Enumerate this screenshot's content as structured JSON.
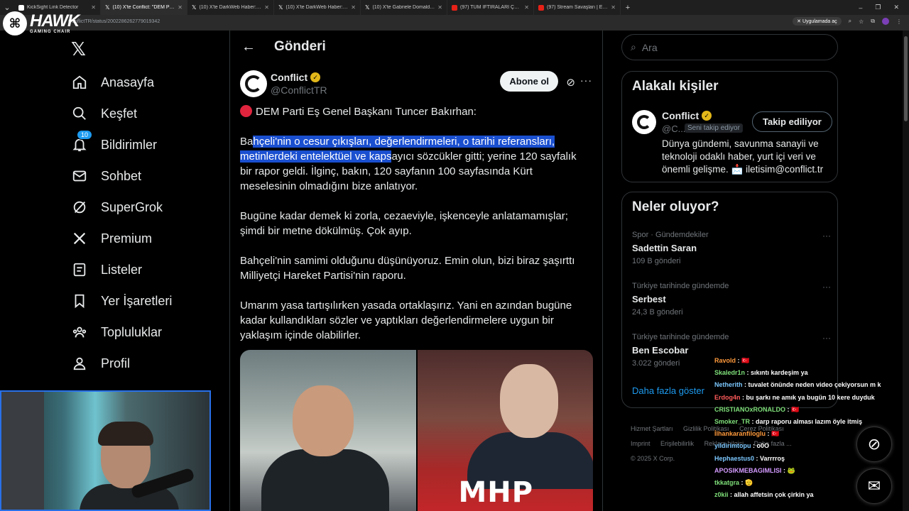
{
  "browser": {
    "tabs": [
      {
        "title": "KickSight Link Detector",
        "active": false,
        "favicon": "kick-icon"
      },
      {
        "title": "(10) X'te Conflict: \"DEM Parti",
        "active": true,
        "favicon": "x-icon"
      },
      {
        "title": "(10) X'te DarkWeb Haber: \"#Son",
        "active": false,
        "favicon": "x-icon"
      },
      {
        "title": "(10) X'te DarkWeb Haber: \"Bilal",
        "active": false,
        "favicon": "x-icon"
      },
      {
        "title": "(10) X'te Gabriele Domaldo: \"Su",
        "active": false,
        "favicon": "x-icon"
      },
      {
        "title": "(97) TÜM İFTİRALARI ÇÖZDÜM",
        "active": false,
        "favicon": "youtube-icon"
      },
      {
        "title": "(97) Stream Savaşları | Ebo x Uz",
        "active": false,
        "favicon": "youtube-icon"
      }
    ],
    "url": "ConflictTR/status/2002286262779019342",
    "install_label": "Uygulamada aç"
  },
  "overlay_logo": {
    "word": "HAWK",
    "sub": "GAMING CHAIR"
  },
  "nav": {
    "items": [
      {
        "label": "Anasayfa",
        "icon": "home-icon"
      },
      {
        "label": "Keşfet",
        "icon": "search-icon"
      },
      {
        "label": "Bildirimler",
        "icon": "bell-icon",
        "badge": "10"
      },
      {
        "label": "Sohbet",
        "icon": "mail-icon"
      },
      {
        "label": "SuperGrok",
        "icon": "grok-icon"
      },
      {
        "label": "Premium",
        "icon": "x-icon"
      },
      {
        "label": "Listeler",
        "icon": "list-icon"
      },
      {
        "label": "Yer İşaretleri",
        "icon": "bookmark-icon"
      },
      {
        "label": "Topluluklar",
        "icon": "communities-icon"
      },
      {
        "label": "Profil",
        "icon": "person-icon"
      }
    ]
  },
  "main": {
    "header_title": "Gönderi",
    "author_name": "Conflict",
    "author_handle": "@ConflictTR",
    "subscribe_label": "Abone ol",
    "p1": "DEM Parti Eş Genel Başkanı Tuncer Bakırhan:",
    "p2_a": "Ba",
    "p2_sel": "hçeli'nin o cesur çıkışları, değerlendirmeleri, o tarihi referansları, metinlerdeki entelektüel ve kaps",
    "p2_b": "ayıcı sözcükler gitti; yerine 120 sayfalık bir rapor geldi. İlginç, bakın, 120 sayfanın 100 sayfasında Kürt meselesinin olmadığını bize anlatıyor.",
    "p3": "Bugüne kadar demek ki zorla, cezaeviyle, işkenceyle anlatamamışlar; şimdi bir metne dökülmüş. Çok ayıp.",
    "p4": "Bahçeli'nin samimi olduğunu düşünüyoruz. Emin olun, bizi biraz şaşırttı Milliyetçi Hareket Partisi'nin raporu.",
    "p5": "Umarım yasa tartışılırken yasada ortaklaşırız. Yani en azından bugüne kadar kullandıkları sözler ve yaptıkları değerlendirmelere uygun bir yaklaşım içinde olabilirler.",
    "image_text": "MHP"
  },
  "right": {
    "search_placeholder": "Ara",
    "related_title": "Alakalı kişiler",
    "related_name": "Conflict",
    "related_handle": "@C...",
    "follows_you": "Seni takip ediyor",
    "following_label": "Takip ediliyor",
    "related_bio": "Dünya gündemi, savunma sanayii ve teknoloji odaklı haber, yurt içi veri ve önemli gelişme. 📩 iletisim@conflict.tr",
    "trends_title": "Neler oluyor?",
    "trends": [
      {
        "context": "Spor · Gündemdekiler",
        "name": "Sadettin Saran",
        "count": "109 B gönderi"
      },
      {
        "context": "Türkiye tarihinde gündemde",
        "name": "Serbest",
        "count": "24,3 B gönderi"
      },
      {
        "context": "Türkiye tarihinde gündemde",
        "name": "Ben Escobar",
        "count": "3.022 gönderi"
      }
    ],
    "show_more": "Daha fazla göster",
    "footer": {
      "terms": "Hizmet Şartları",
      "privacy": "Gizlilik Politikası",
      "cookie": "Çerez Politikası",
      "imprint": "Imprint",
      "accessibility": "Erişilebilirlik",
      "ads": "Reklam bilgisi",
      "more": "Daha fazla ...",
      "copyright": "© 2025 X Corp."
    }
  },
  "chat": [
    {
      "user": "Ravold",
      "text": "🇹🇷",
      "color": "o"
    },
    {
      "user": "Skaledr1n",
      "text": "sıkıntı kardeşim ya",
      "color": "g"
    },
    {
      "user": "Netherith",
      "text": "tuvalet önünde neden video çekiyorsun m k",
      "color": ""
    },
    {
      "user": "Erdog4n",
      "text": "bu şarkı ne amık ya bugün 10 kere duyduk",
      "color": "r"
    },
    {
      "user": "CRISTIANOxRONALDO",
      "text": "🇹🇷",
      "color": "g"
    },
    {
      "user": "Smoker_TR",
      "text": "darp raporu alması lazım öyle itmiş",
      "color": "g"
    },
    {
      "user": "İlhankaranfiloglu",
      "text": "🇹🇷",
      "color": "o"
    },
    {
      "user": "yildirimtopu",
      "text": "o0O",
      "color": ""
    },
    {
      "user": "Hephaestus0",
      "text": "Varrrroş",
      "color": ""
    },
    {
      "user": "APOSIKMEBAGIMLISI",
      "text": "🐸",
      "color": "p"
    },
    {
      "user": "tkkatgra",
      "text": "🫡",
      "color": "g"
    },
    {
      "user": "z0kii",
      "text": "allah affetsin çok çirkin ya",
      "color": "g"
    }
  ]
}
